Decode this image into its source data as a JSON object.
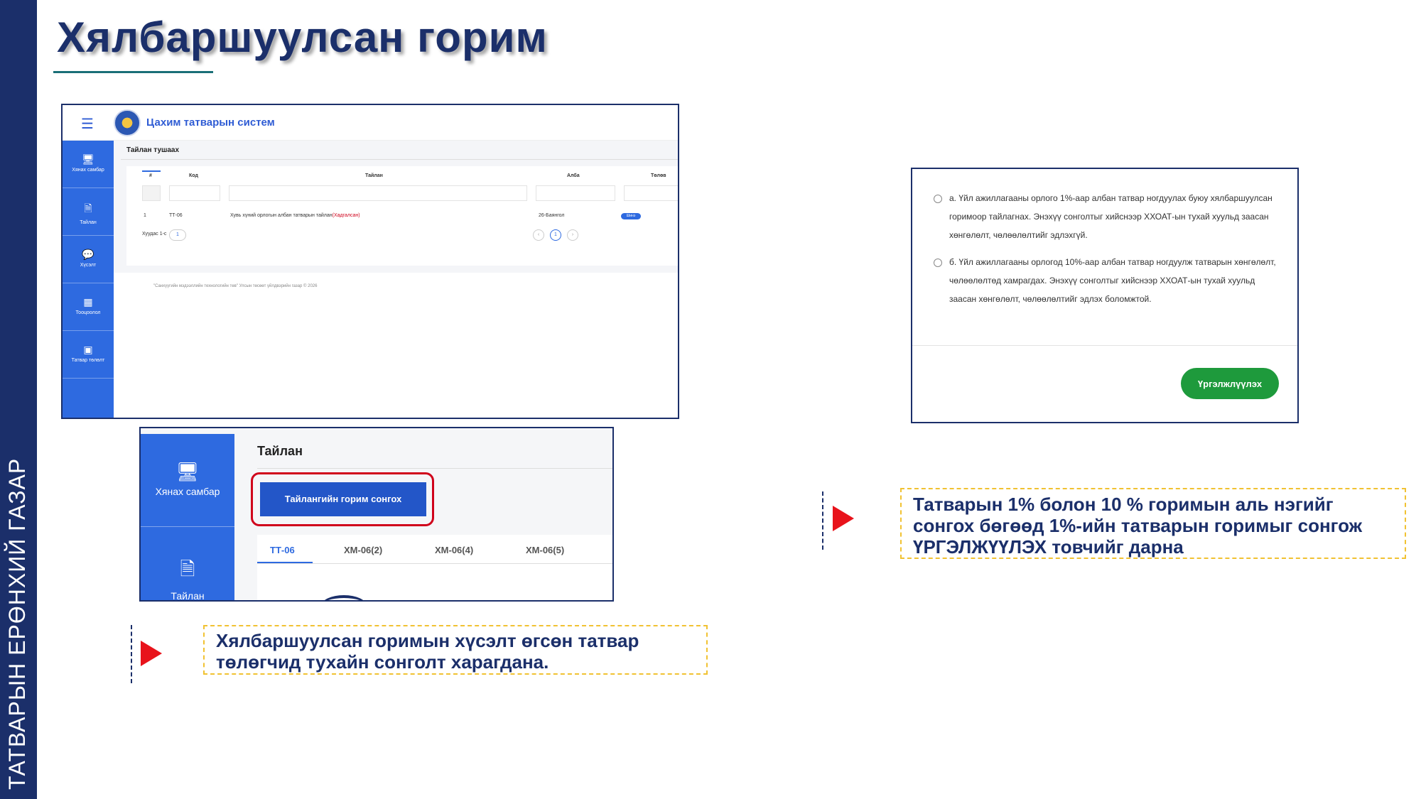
{
  "side_label": "ТАТВАРЫН ЕРӨНХИЙ ГАЗАР",
  "page_title": "Хялбаршуулсан горим",
  "shot1": {
    "system_name": "Цахим татварын систем",
    "nav": [
      {
        "label": "Хянах самбар",
        "icon": "monitor-icon"
      },
      {
        "label": "Тайлан",
        "icon": "report-icon"
      },
      {
        "label": "Хүсэлт",
        "icon": "chat-icon"
      },
      {
        "label": "Тооцоолол",
        "icon": "calculator-icon"
      },
      {
        "label": "Татвар төлөлт",
        "icon": "payment-icon"
      }
    ],
    "section_title": "Тайлан тушаах",
    "columns": [
      "#",
      "Код",
      "Тайлан",
      "Алба",
      "Төлөв"
    ],
    "row": {
      "num": "1",
      "code": "ТТ-06",
      "report": "Хувь хүний орлогын албан татварын тайлан",
      "report_note": "(Хадгалсан)",
      "office": "26-Баянгол"
    },
    "badge": "Шинэ",
    "pager_label": "Хуудас 1-с",
    "pager_select": "1",
    "page_number": "1",
    "footer": "\"Санхүүгийн мэдээллийн технологийн төв\" Улсын төсөөт үйлдвэрийн газар © 2026"
  },
  "shot2": {
    "nav": [
      {
        "label": "Хянах самбар",
        "icon": "monitor-icon"
      },
      {
        "label": "Тайлан",
        "icon": "report-icon"
      }
    ],
    "title": "Тайлан",
    "button": "Тайлангийн горим сонгох",
    "tabs": [
      "ТТ-06",
      "ХМ-06(2)",
      "ХМ-06(4)",
      "ХМ-06(5)"
    ]
  },
  "shot3": {
    "option_a": "а. Үйл ажиллагааны орлого 1%-аар албан татвар ногдуулах буюу хялбаршуулсан горимоор тайлагнах. Энэхүү сонголтыг хийснээр ХХОАТ-ын тухай хуульд заасан хөнгөлөлт, чөлөөлөлтийг эдлэхгүй.",
    "option_b": "б. Үйл ажиллагааны орлогод 10%-аар албан татвар ногдуулж татварын хөнгөлөлт, чөлөөлөлтөд хамрагдах. Энэхүү сонголтыг хийснээр ХХОАТ-ын тухай хуульд заасан хөнгөлөлт, чөлөөлөлтийг эдлэх боломжтой.",
    "continue": "Үргэлжлүүлэх"
  },
  "callout1": "Хялбаршуулсан горимын хүсэлт өгсөн татвар төлөгчид тухайн сонголт харагдана.",
  "callout2": "Татварын 1% болон 10 % горимын аль нэгийг сонгох бөгөөд 1%-ийн  татварын горимыг сонгож ҮРГЭЛЖҮҮЛЭХ товчийг дарна",
  "colors": {
    "navy": "#1b2f6a",
    "primary_blue": "#2e6ae0",
    "highlight_red": "#d0021b",
    "arrow_red": "#e8131b",
    "callout_border": "#f1c232",
    "continue_green": "#1e9a3c"
  }
}
